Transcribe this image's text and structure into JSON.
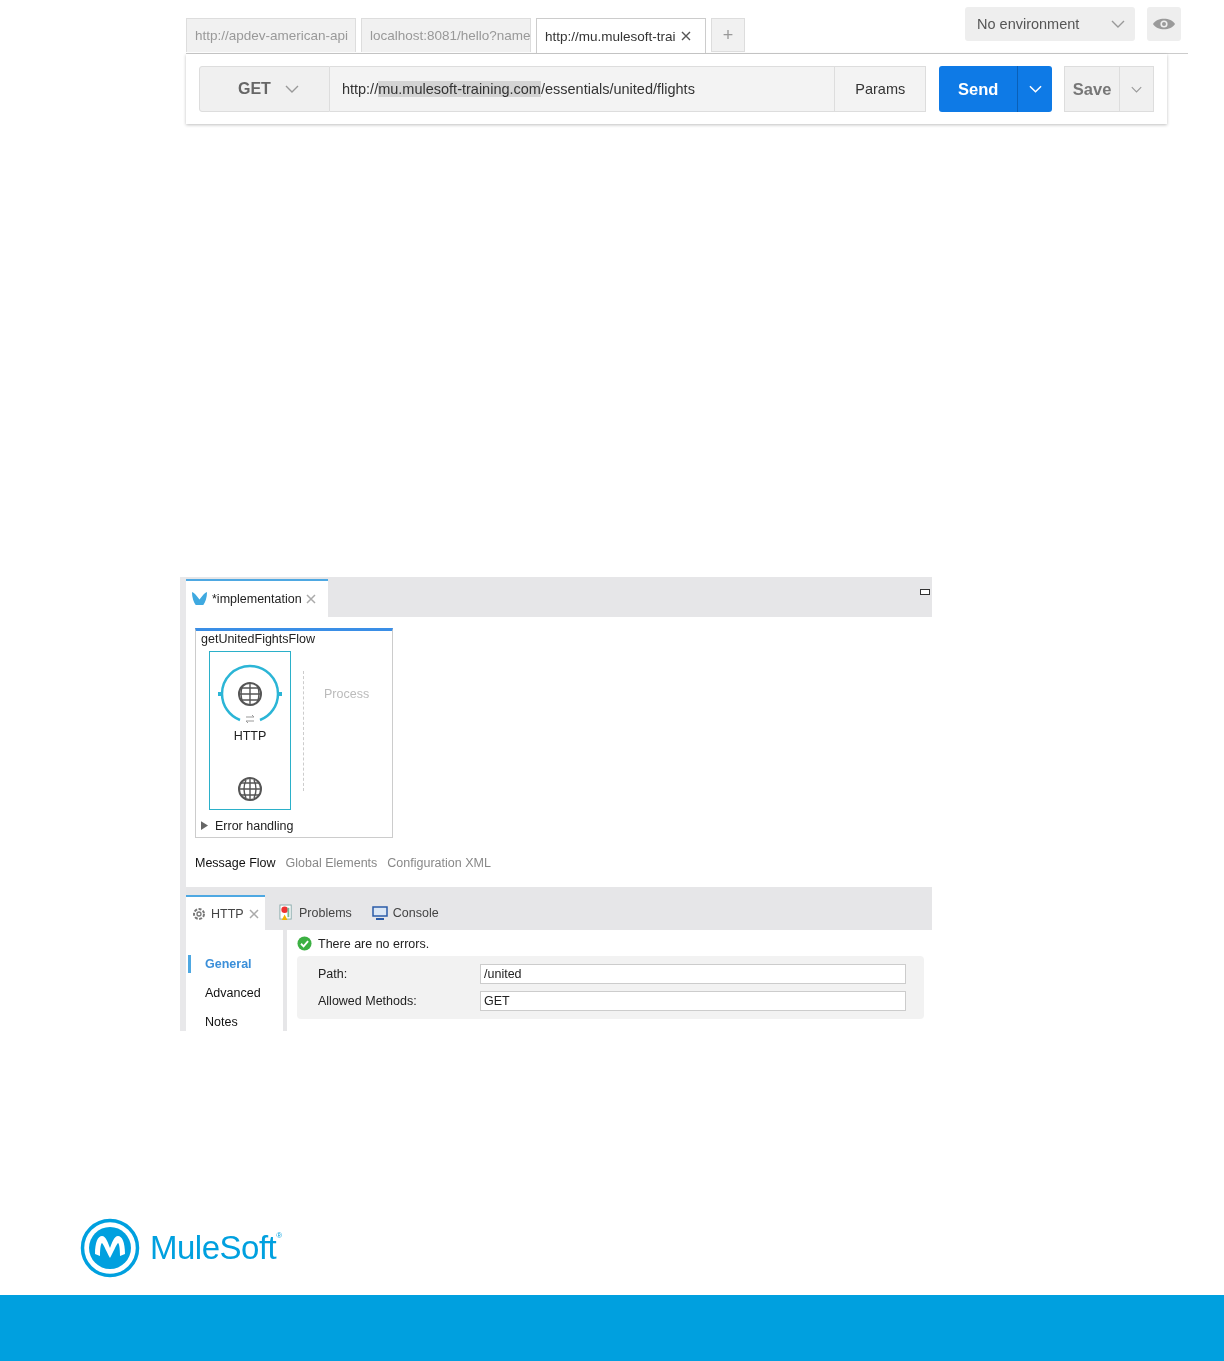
{
  "postman": {
    "tabs": [
      {
        "label": "http://apdev-american-api",
        "selected": false
      },
      {
        "label": "localhost:8081/hello?name",
        "selected": false
      },
      {
        "label": "http://mu.mulesoft-trai",
        "selected": true
      }
    ],
    "new_tab": "+",
    "environment": "No environment",
    "method": "GET",
    "url": {
      "before": "http://",
      "selected": "mu.mulesoft-training.com",
      "after": "/essentials/united/flights"
    },
    "params": "Params",
    "send": "Send",
    "save": "Save"
  },
  "studio": {
    "editor_tab": "*implementation",
    "flow": {
      "name": "getUnitedFightsFlow",
      "source": "HTTP",
      "process": "Process",
      "error_handling": "Error handling",
      "error_expanded": false
    },
    "canvas_tabs": [
      {
        "label": "Message Flow",
        "selected": true
      },
      {
        "label": "Global Elements",
        "selected": false
      },
      {
        "label": "Configuration XML",
        "selected": false
      }
    ],
    "view_tabs": [
      {
        "label": "HTTP",
        "kind": "connector",
        "selected": true
      },
      {
        "label": "Problems",
        "kind": "problems",
        "selected": false
      },
      {
        "label": "Console",
        "kind": "console",
        "selected": false
      }
    ],
    "status": "There are no errors.",
    "sections": [
      {
        "label": "General",
        "selected": true
      },
      {
        "label": "Advanced",
        "selected": false
      },
      {
        "label": "Notes",
        "selected": false
      }
    ],
    "fields": [
      {
        "label": "Path:",
        "value": "/united"
      },
      {
        "label": "Allowed Methods:",
        "value": "GET"
      }
    ]
  },
  "logo": {
    "wordmark": "MuleSoft",
    "mark": "®"
  }
}
